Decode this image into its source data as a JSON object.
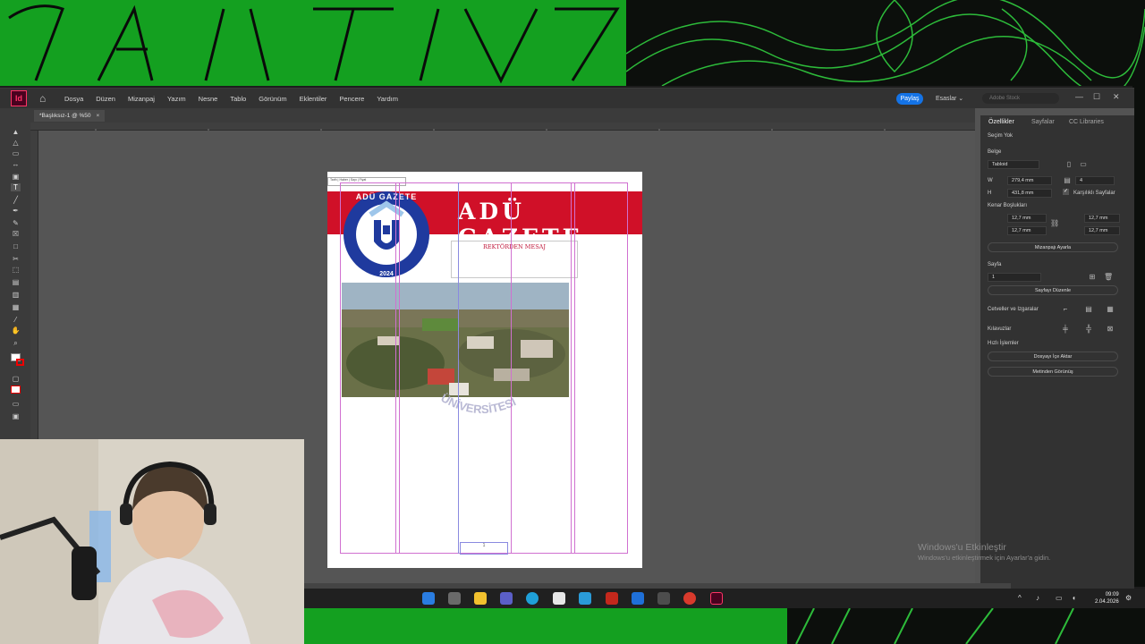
{
  "app": {
    "logo": "Id",
    "menu": [
      "Dosya",
      "Düzen",
      "Mizanpaj",
      "Yazım",
      "Nesne",
      "Tablo",
      "Görünüm",
      "Eklentiler",
      "Pencere",
      "Yardım"
    ],
    "share_label": "Paylaş",
    "workspace_label": "Esaslar",
    "stock_placeholder": "Adobe Stock",
    "doc_tab": "*Başlıksız-1 @ %50",
    "doc_tab_close": "×"
  },
  "page": {
    "slug_text": "Tarih | Haber | Sayı | Fiyat",
    "masthead_title": "ADÜ GAZETE",
    "logo_top_text": "ADÜ GAZETE",
    "logo_year": "2024",
    "section_heading": "REKTÖRDEN MESAJ",
    "watermark_arc_text": "ÜNİVERSİTESİ",
    "page_number_marker": "1"
  },
  "panel": {
    "tabs": [
      "Özellikler",
      "Sayfalar",
      "CC Libraries"
    ],
    "selection": "Seçim Yok",
    "document_label": "Belge",
    "preset": "Tabloid",
    "width_label": "W",
    "width_value": "279,4 mm",
    "height_label": "H",
    "height_value": "431,8 mm",
    "pages_value": "4",
    "facing_pages": "Karşılıklı Sayfalar",
    "margins_label": "Kenar Boşlukları",
    "margin_top": "12,7 mm",
    "margin_bottom": "12,7 mm",
    "margin_left": "12,7 mm",
    "margin_right": "12,7 mm",
    "layout_settings": "Mizanpajı Ayarla",
    "page_label": "Sayfa",
    "page_value": "1",
    "edit_page": "Sayfayı Düzenle",
    "grids_label": "Cetveller ve Izgaralar",
    "guides_label": "Kılavuzlar",
    "quick_actions_label": "Hızlı İşlemler",
    "import_file": "Dosyayı İçe Aktar",
    "convert_text": "Metinden Görünüş"
  },
  "taskbar": {
    "time": "09:09",
    "date": "2.04.2026"
  },
  "activation": {
    "title": "Windows'u Etkinleştir",
    "subtitle": "Windows'u etkinleştirmek için Ayarlar'a gidin."
  },
  "colors": {
    "masthead_red": "#d01028",
    "logo_blue": "#1f3a9e",
    "wallpaper_green": "#14a020",
    "share_blue": "#1473e6"
  }
}
